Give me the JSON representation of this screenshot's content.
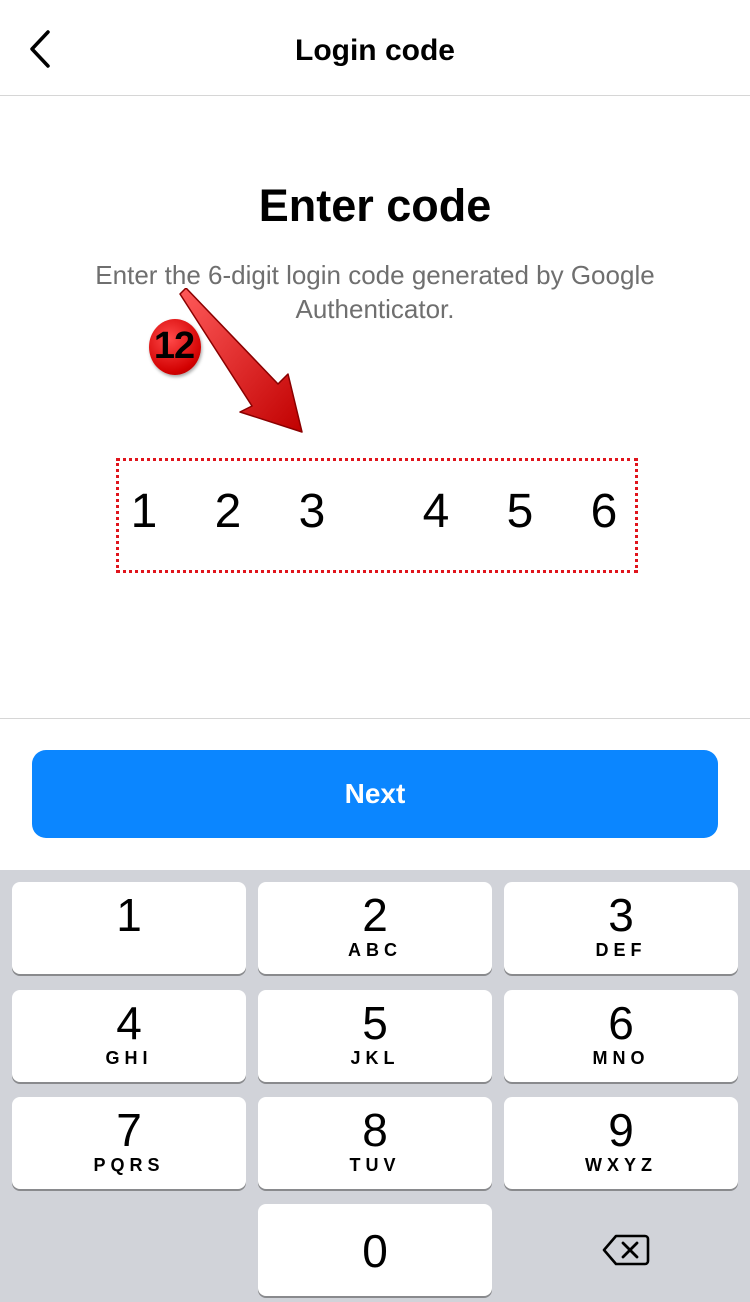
{
  "header": {
    "title": "Login code",
    "back_icon": "chevron-left-icon"
  },
  "main": {
    "heading": "Enter code",
    "instructions": "Enter the 6-digit login code generated by Google Authenticator.",
    "code_digits": [
      "1",
      "2",
      "3",
      "4",
      "5",
      "6"
    ]
  },
  "annotation": {
    "step_label": "12",
    "marker_color": "#e01010",
    "arrow_color": "#e01010"
  },
  "actions": {
    "next_label": "Next",
    "accent_color": "#0b86ff"
  },
  "keypad": {
    "keys": [
      {
        "num": "1",
        "letters": ""
      },
      {
        "num": "2",
        "letters": "ABC"
      },
      {
        "num": "3",
        "letters": "DEF"
      },
      {
        "num": "4",
        "letters": "GHI"
      },
      {
        "num": "5",
        "letters": "JKL"
      },
      {
        "num": "6",
        "letters": "MNO"
      },
      {
        "num": "7",
        "letters": "PQRS"
      },
      {
        "num": "8",
        "letters": "TUV"
      },
      {
        "num": "9",
        "letters": "WXYZ"
      },
      {
        "num": "0",
        "letters": ""
      }
    ],
    "backspace_icon": "backspace-icon"
  }
}
